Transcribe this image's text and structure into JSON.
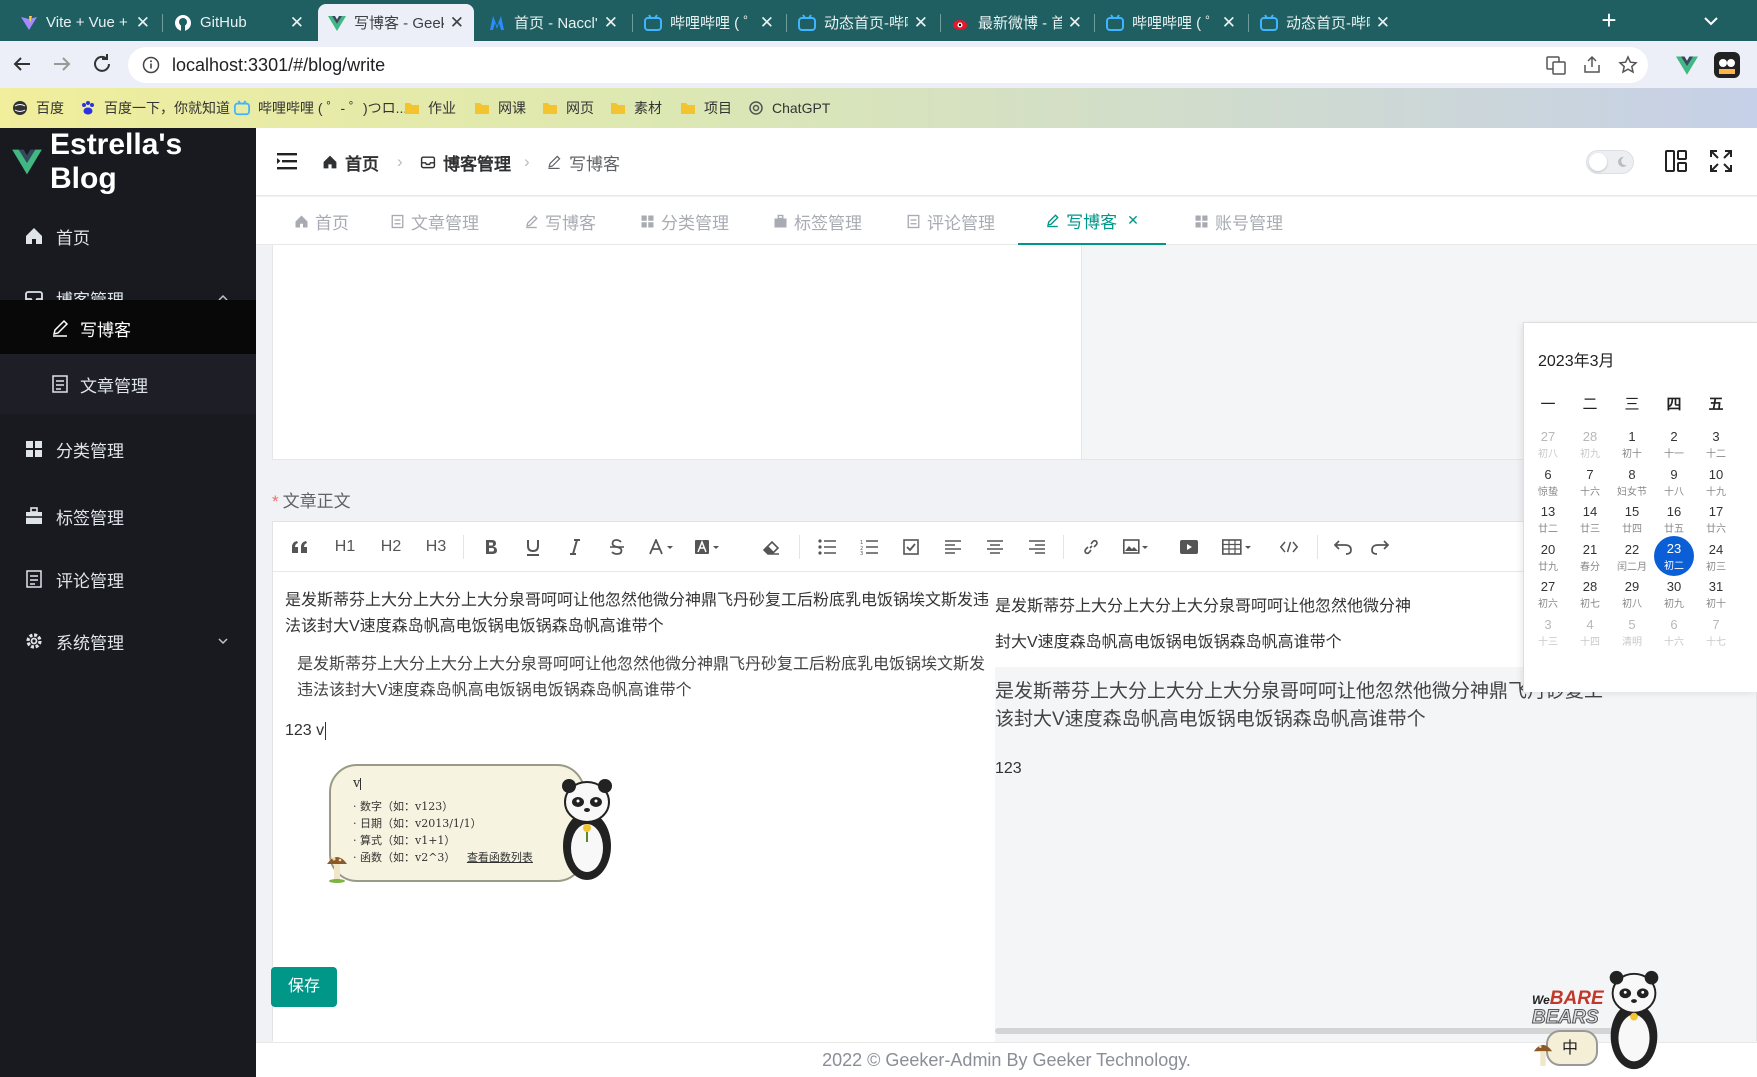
{
  "browser": {
    "tabs": [
      {
        "label": "Vite + Vue + T",
        "icon": "vite-icon"
      },
      {
        "label": "GitHub",
        "icon": "github-icon"
      },
      {
        "label": "写博客 - Geeke",
        "icon": "vue-icon"
      },
      {
        "label": "首页 - Naccl's",
        "icon": "naccl-icon"
      },
      {
        "label": "哔哩哔哩 ( ゜- ゜",
        "icon": "bilibili-icon"
      },
      {
        "label": "动态首页-哔哩",
        "icon": "bilibili-icon"
      },
      {
        "label": "最新微博 - 首页",
        "icon": "weibo-icon"
      },
      {
        "label": "哔哩哔哩 ( ゜- ゜",
        "icon": "bilibili-icon"
      },
      {
        "label": "动态首页-哔哩",
        "icon": "bilibili-icon"
      }
    ],
    "url": "localhost:3301/#/blog/write",
    "bookmarks": [
      "百度",
      "百度一下，你就知道",
      "哔哩哔哩 ( ゜- ゜)つロ...",
      "作业",
      "网课",
      "网页",
      "素材",
      "项目",
      "ChatGPT"
    ]
  },
  "app": {
    "logo_text": "Estrella's Blog",
    "menu": {
      "home": "首页",
      "blog": "博客管理",
      "write": "写博客",
      "articles": "文章管理",
      "category": "分类管理",
      "tag": "标签管理",
      "comment": "评论管理",
      "system": "系统管理"
    },
    "breadcrumb": [
      "首页",
      "博客管理",
      "写博客"
    ],
    "tabs": [
      "首页",
      "文章管理",
      "写博客",
      "分类管理",
      "标签管理",
      "评论管理",
      "写博客",
      "账号管理"
    ],
    "theme_toggle": "dark-mode off"
  },
  "editor": {
    "label": "文章正文",
    "required_mark": "*",
    "toolbar": {
      "h1": "H1",
      "h2": "H2",
      "h3": "H3"
    },
    "content": {
      "para1": "是发斯蒂芬上大分上大分上大分泉哥呵呵让他忽然他微分神鼎飞丹砂复工后粉底乳电饭锅埃文斯发违法该封大V速度森岛帆高电饭锅电饭锅森岛帆高谁带个",
      "para2": "是发斯蒂芬上大分上大分上大分泉哥呵呵让他忽然他微分神鼎飞丹砂复工后粉底乳电饭锅埃文斯发违法该封大V速度森岛帆高电饭锅电饭锅森岛帆高谁带个",
      "line3": "123 v"
    },
    "preview": {
      "p1a": "是发斯蒂芬上大分上大分上大分泉哥呵呵让他忽然他微分神",
      "p1b": "封大V速度森岛帆高电饭锅电饭锅森岛帆高谁带个",
      "p2a": "是发斯蒂芬上大分上大分上大分泉哥呵呵让他忽然他微分神鼎飞丹砂复工",
      "p2b": "该封大V速度森岛帆高电饭锅电饭锅森岛帆高谁带个",
      "p3": "123"
    },
    "ime_popup": {
      "input": "v",
      "items": [
        "数字（如：v123）",
        "日期（如：v2013/1/1）",
        "算式（如：v1+1）",
        "函数（如：v2^3）"
      ],
      "link": "查看函数列表"
    },
    "save_button": "保存"
  },
  "calendar": {
    "title": "2023年3月",
    "weekdays": [
      "一",
      "二",
      "三",
      "四",
      "五"
    ],
    "rows": [
      [
        [
          "27",
          "初八",
          1
        ],
        [
          "28",
          "初九",
          1
        ],
        [
          "1",
          "初十",
          0
        ],
        [
          "2",
          "十一",
          0
        ],
        [
          "3",
          "十二",
          0
        ]
      ],
      [
        [
          "6",
          "惊蛰",
          0
        ],
        [
          "7",
          "十六",
          0
        ],
        [
          "8",
          "妇女节",
          0
        ],
        [
          "9",
          "十八",
          0
        ],
        [
          "10",
          "十九",
          0
        ]
      ],
      [
        [
          "13",
          "廿二",
          0
        ],
        [
          "14",
          "廿三",
          0
        ],
        [
          "15",
          "廿四",
          0
        ],
        [
          "16",
          "廿五",
          0
        ],
        [
          "17",
          "廿六",
          0
        ]
      ],
      [
        [
          "20",
          "廿九",
          0
        ],
        [
          "21",
          "春分",
          0
        ],
        [
          "22",
          "闰二月",
          0
        ],
        [
          "23",
          "初二",
          2
        ],
        [
          "24",
          "初三",
          0
        ]
      ],
      [
        [
          "27",
          "初六",
          0
        ],
        [
          "28",
          "初七",
          0
        ],
        [
          "29",
          "初八",
          0
        ],
        [
          "30",
          "初九",
          0
        ],
        [
          "31",
          "初十",
          0
        ]
      ],
      [
        [
          "3",
          "十三",
          1
        ],
        [
          "4",
          "十四",
          1
        ],
        [
          "5",
          "清明",
          1
        ],
        [
          "6",
          "十六",
          1
        ],
        [
          "7",
          "十七",
          1
        ]
      ]
    ]
  },
  "ime_status": {
    "lang": "中"
  },
  "footer": "2022 © Geeker-Admin By Geeker Technology.",
  "colors": {
    "primary": "#009688",
    "sidebar": "#191a20",
    "chrome": "#1f5f61",
    "calendar_selected": "#0a5fd6"
  }
}
